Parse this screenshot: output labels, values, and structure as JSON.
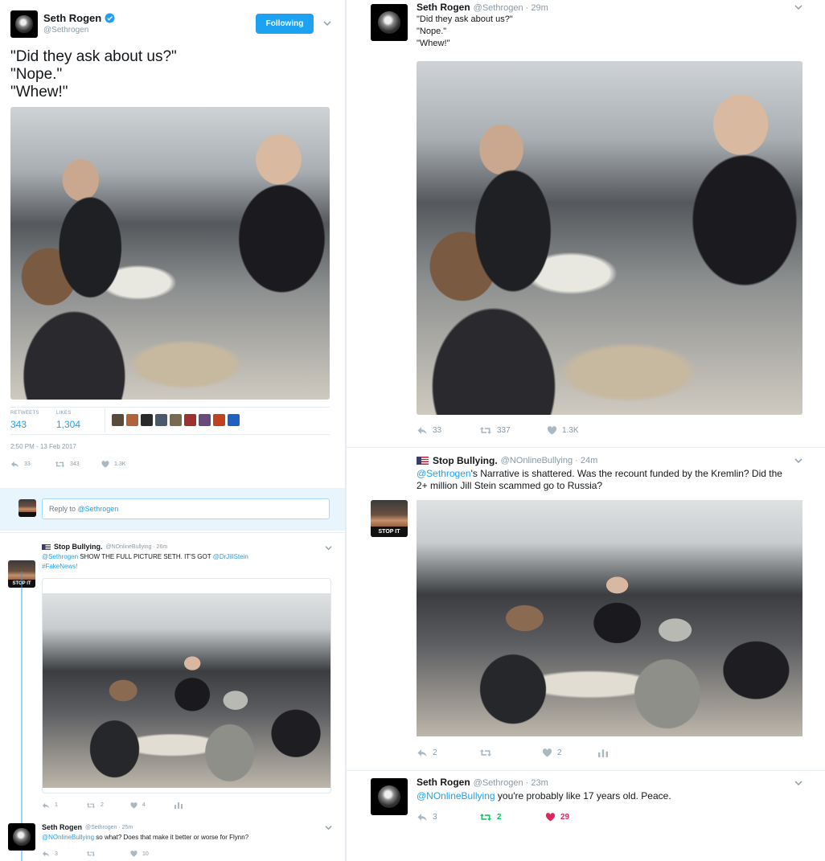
{
  "left_main": {
    "name": "Seth Rogen",
    "handle": "@Sethrogen",
    "follow_label": "Following",
    "lines": [
      "\"Did they ask about us?\"",
      "\"Nope.\"",
      "\"Whew!\""
    ],
    "retweets_label": "RETWEETS",
    "retweets": "343",
    "likes_label": "LIKES",
    "likes": "1,304",
    "timestamp": "2:50 PM - 13 Feb 2017",
    "replies_count": "33",
    "retweet_count": "343",
    "like_count": "1.3K",
    "reply_label": "Reply to",
    "reply_mention": "@Sethrogen"
  },
  "left_reply1": {
    "name": "Stop Bullying.",
    "handle": "@NOnlineBullying · 26m",
    "mention": "@Sethrogen",
    "text": "SHOW THE FULL PICTURE SETH. IT'S GOT",
    "mention2": "@DrJillStein",
    "hashtag": "#FakeNews!",
    "replies": "1",
    "retweets": "2",
    "likes": "4"
  },
  "left_reply2": {
    "name": "Seth Rogen",
    "handle": "@Sethrogen · 25m",
    "mention": "@NOnlineBullying",
    "text": "so what? Does that make it better or worse for Flynn?",
    "replies": "3",
    "retweets": "",
    "likes": "10"
  },
  "right_tweet1": {
    "name": "Seth Rogen",
    "handle": "@Sethrogen · 29m",
    "lines": [
      "\"Did they ask about us?\"",
      "\"Nope.\"",
      "\"Whew!\""
    ],
    "replies": "33",
    "retweets": "337",
    "likes": "1.3K"
  },
  "right_tweet2": {
    "name": "Stop Bullying.",
    "handle": "@NOnlineBullying · 24m",
    "mention": "@Sethrogen",
    "text": "'s Narrative is shattered. Was the recount funded by the Kremlin? Did the 2+ million Jill Stein scammed go to Russia?",
    "replies": "2",
    "retweets": "",
    "likes": "2"
  },
  "right_tweet3": {
    "name": "Seth Rogen",
    "handle": "@Sethrogen · 23m",
    "mention": "@NOnlineBullying",
    "text": "you're probably like 17 years old. Peace.",
    "replies": "3",
    "retweets": "2",
    "likes": "29"
  },
  "avatar_badge": "STOP IT",
  "colors": {
    "accent": "#1da1f2",
    "retweet_active": "#17bf63",
    "like_active": "#e0245e",
    "muted": "#8899a6"
  }
}
